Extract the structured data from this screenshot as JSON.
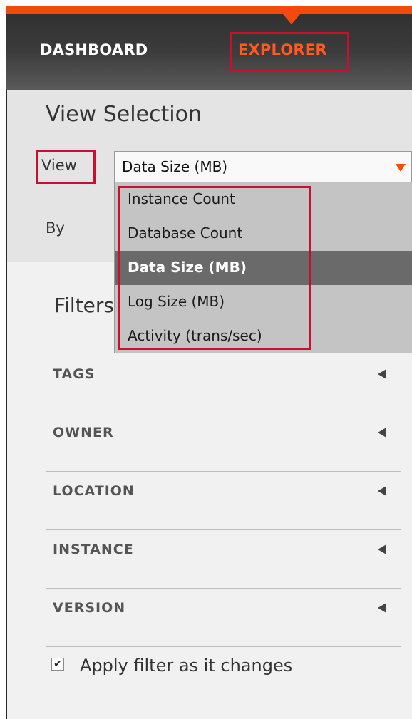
{
  "nav": {
    "tabs": [
      {
        "label": "DASHBOARD",
        "active": false
      },
      {
        "label": "EXPLORER",
        "active": true
      }
    ],
    "accent_color": "#f24a0c"
  },
  "view_selection": {
    "title": "View Selection",
    "view_label": "View",
    "by_label": "By",
    "select": {
      "value": "Data Size (MB)",
      "options": [
        {
          "label": "Instance Count",
          "selected": false
        },
        {
          "label": "Database Count",
          "selected": false
        },
        {
          "label": "Data Size (MB)",
          "selected": true
        },
        {
          "label": "Log Size (MB)",
          "selected": false
        },
        {
          "label": "Activity (trans/sec)",
          "selected": false
        }
      ]
    }
  },
  "filters": {
    "title": "Filters",
    "items": [
      {
        "label": "TAGS"
      },
      {
        "label": "OWNER"
      },
      {
        "label": "LOCATION"
      },
      {
        "label": "INSTANCE"
      },
      {
        "label": "VERSION"
      }
    ],
    "apply_checkbox": {
      "label": "Apply filter as it changes",
      "checked": true,
      "mark": "✔"
    }
  },
  "annotation_color": "#c8102e",
  "icons": {
    "dropdown_arrow": "dropdown-arrow-icon",
    "collapse_caret": "caret-left-icon",
    "tab_pointer": "tab-pointer-icon"
  }
}
